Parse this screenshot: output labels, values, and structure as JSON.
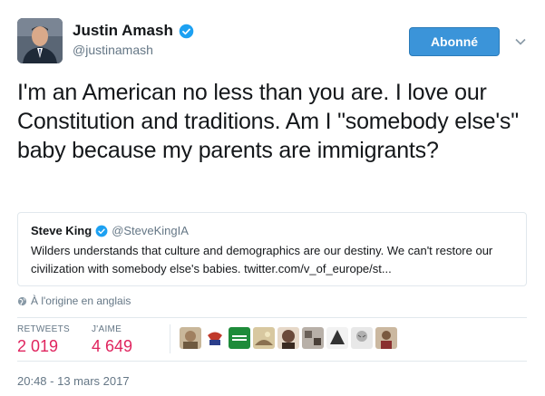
{
  "author": {
    "display_name": "Justin Amash",
    "handle": "@justinamash",
    "verified": true
  },
  "follow_button_label": "Abonné",
  "tweet": {
    "text": "I'm an American no less than you are. I love our Constitution and traditions. Am I \"somebody else's\" baby because my parents are immigrants?"
  },
  "quoted_tweet": {
    "display_name": "Steve King",
    "handle": "@SteveKingIA",
    "verified": true,
    "text": "Wilders understands that culture and demographics are our destiny. We can't restore our civilization with somebody else's babies. twitter.com/v_of_europe/st..."
  },
  "translate_label": "À l'origine en anglais",
  "stats": {
    "retweets_label": "RETWEETS",
    "retweets_value": "2 019",
    "likes_label": "J'AIME",
    "likes_value": "4 649"
  },
  "likers": [
    {
      "name": "liker-avatar-1",
      "color": "#a08060"
    },
    {
      "name": "liker-avatar-2",
      "color": "#c0392b",
      "label": "USA"
    },
    {
      "name": "liker-avatar-3",
      "color": "#1e8b3a",
      "label": "IRISH STAND"
    },
    {
      "name": "liker-avatar-4",
      "color": "#b8a070"
    },
    {
      "name": "liker-avatar-5",
      "color": "#6b4a3a"
    },
    {
      "name": "liker-avatar-6",
      "color": "#9a8a80"
    },
    {
      "name": "liker-avatar-7",
      "color": "#333333"
    },
    {
      "name": "liker-avatar-8",
      "color": "#d8d8d8"
    },
    {
      "name": "liker-avatar-9",
      "color": "#7a5a40"
    }
  ],
  "timestamp": "20:48 - 13 mars 2017",
  "colors": {
    "accent": "#3b94d9",
    "stat_value": "#e0245e",
    "muted": "#657786"
  },
  "icons": {
    "verified": "verified-badge-icon",
    "caret": "chevron-down-icon",
    "globe": "globe-icon"
  }
}
